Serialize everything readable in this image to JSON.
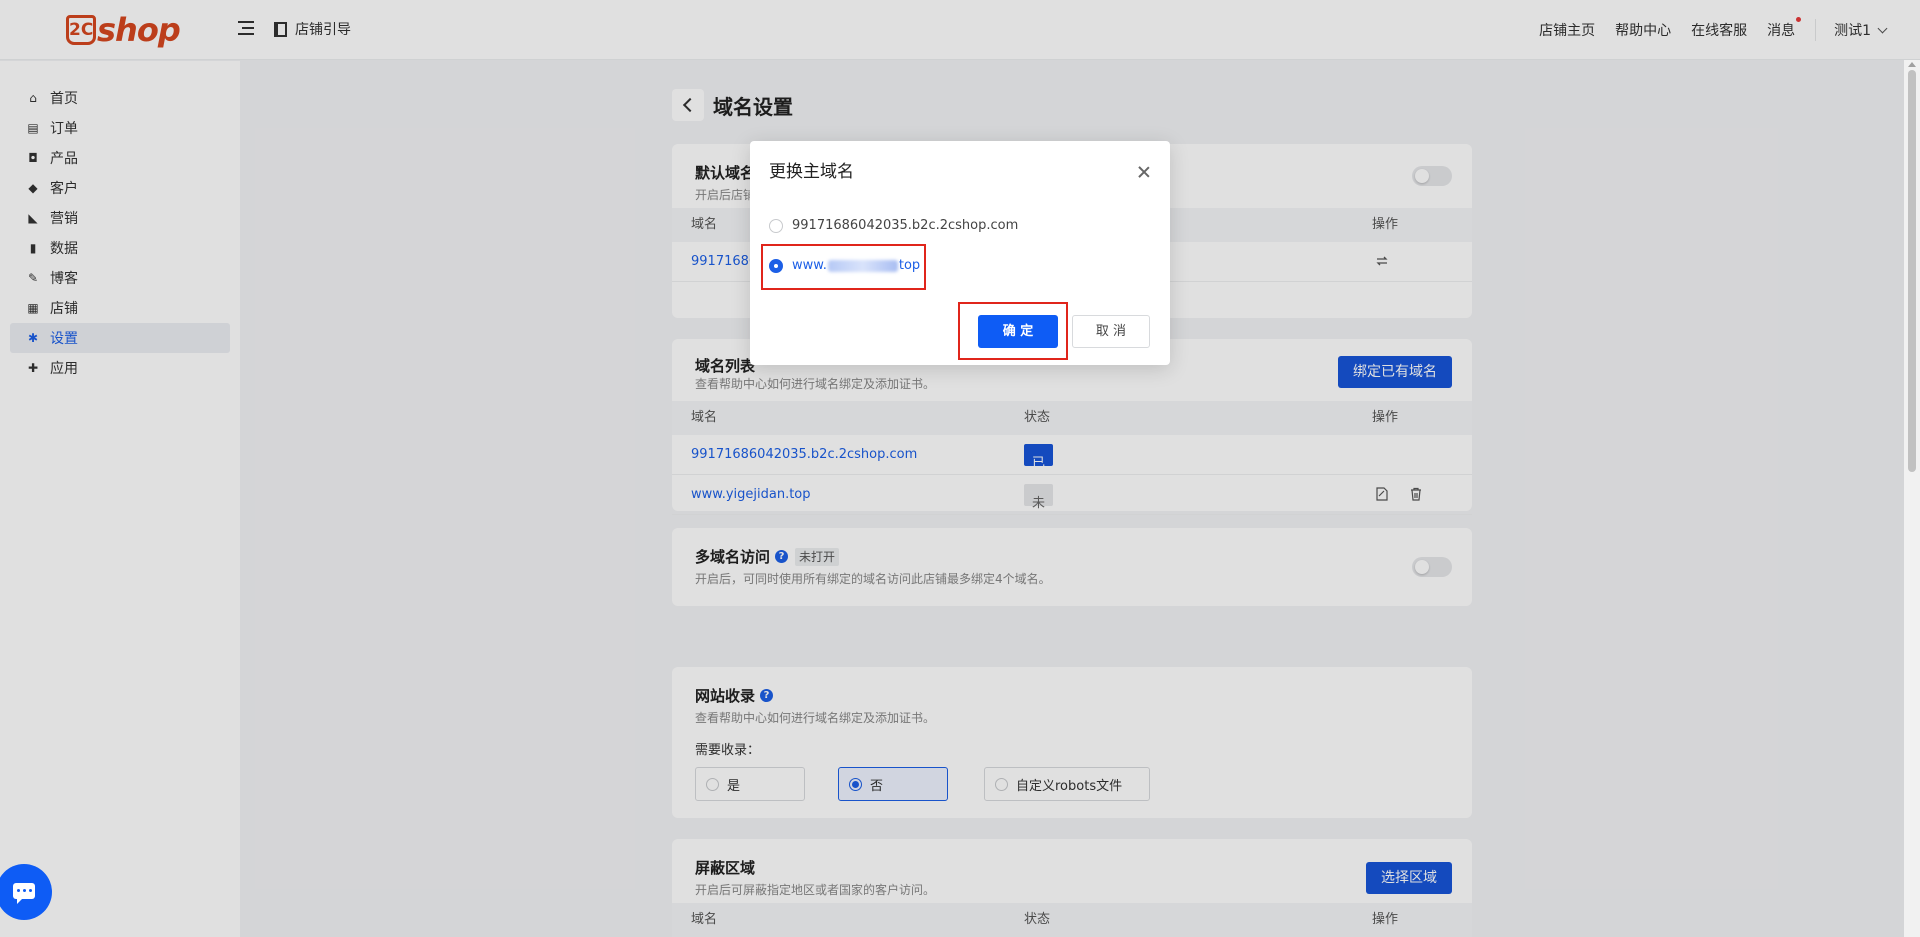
{
  "header": {
    "logo_mark": "2C",
    "logo_text": "shop",
    "guide_label": "店铺引导",
    "links": [
      "店铺主页",
      "帮助中心",
      "在线客服",
      "消息"
    ],
    "user_name": "测试1"
  },
  "sidebar": {
    "items": [
      {
        "label": "首页",
        "icon": "home-icon"
      },
      {
        "label": "订单",
        "icon": "order-icon"
      },
      {
        "label": "产品",
        "icon": "bag-icon"
      },
      {
        "label": "客户",
        "icon": "diamond-icon"
      },
      {
        "label": "营销",
        "icon": "tag-icon"
      },
      {
        "label": "数据",
        "icon": "bar-chart-icon"
      },
      {
        "label": "博客",
        "icon": "blog-icon"
      },
      {
        "label": "店铺",
        "icon": "store-icon"
      },
      {
        "label": "设置",
        "icon": "gear-icon"
      },
      {
        "label": "应用",
        "icon": "puzzle-icon"
      }
    ],
    "active_index": 8
  },
  "page": {
    "title": "域名设置"
  },
  "default_domain": {
    "title": "默认域名",
    "subtitle": "开启后店铺",
    "col_domain": "域名",
    "col_action": "操作",
    "row_domain": "99171686"
  },
  "domain_list": {
    "title": "域名列表",
    "subtitle": "查看帮助中心如何进行域名绑定及添加证书。",
    "bind_button": "绑定已有域名",
    "col_domain": "域名",
    "col_status": "状态",
    "col_action": "操作",
    "rows": [
      {
        "domain": "99171686042035.b2c.2cshop.com",
        "status": "已连接"
      },
      {
        "domain": "www.yigejidan.top",
        "status": "未连接"
      }
    ]
  },
  "multi_domain": {
    "title": "多域名访问",
    "tag": "未打开",
    "subtitle": "开启后，可同时使用所有绑定的域名访问此店铺最多绑定4个域名。"
  },
  "indexing": {
    "title": "网站收录",
    "subtitle": "查看帮助中心如何进行域名绑定及添加证书。",
    "need_label": "需要收录：",
    "options": [
      "是",
      "否",
      "自定义robots文件"
    ],
    "selected": "否"
  },
  "block_region": {
    "title": "屏蔽区域",
    "subtitle": "开启后可屏蔽指定地区或者国家的客户访问。",
    "select_button": "选择区域",
    "col_domain": "域名",
    "col_status": "状态",
    "col_action": "操作"
  },
  "modal": {
    "title": "更换主域名",
    "option1": "99171686042035.b2c.2cshop.com",
    "option2_prefix": "www.",
    "option2_suffix": "top",
    "ok_label": "确 定",
    "cancel_label": "取 消"
  },
  "colors": {
    "brand": "#d6471f",
    "primary": "#1755d9",
    "highlight": "#e0251b"
  }
}
